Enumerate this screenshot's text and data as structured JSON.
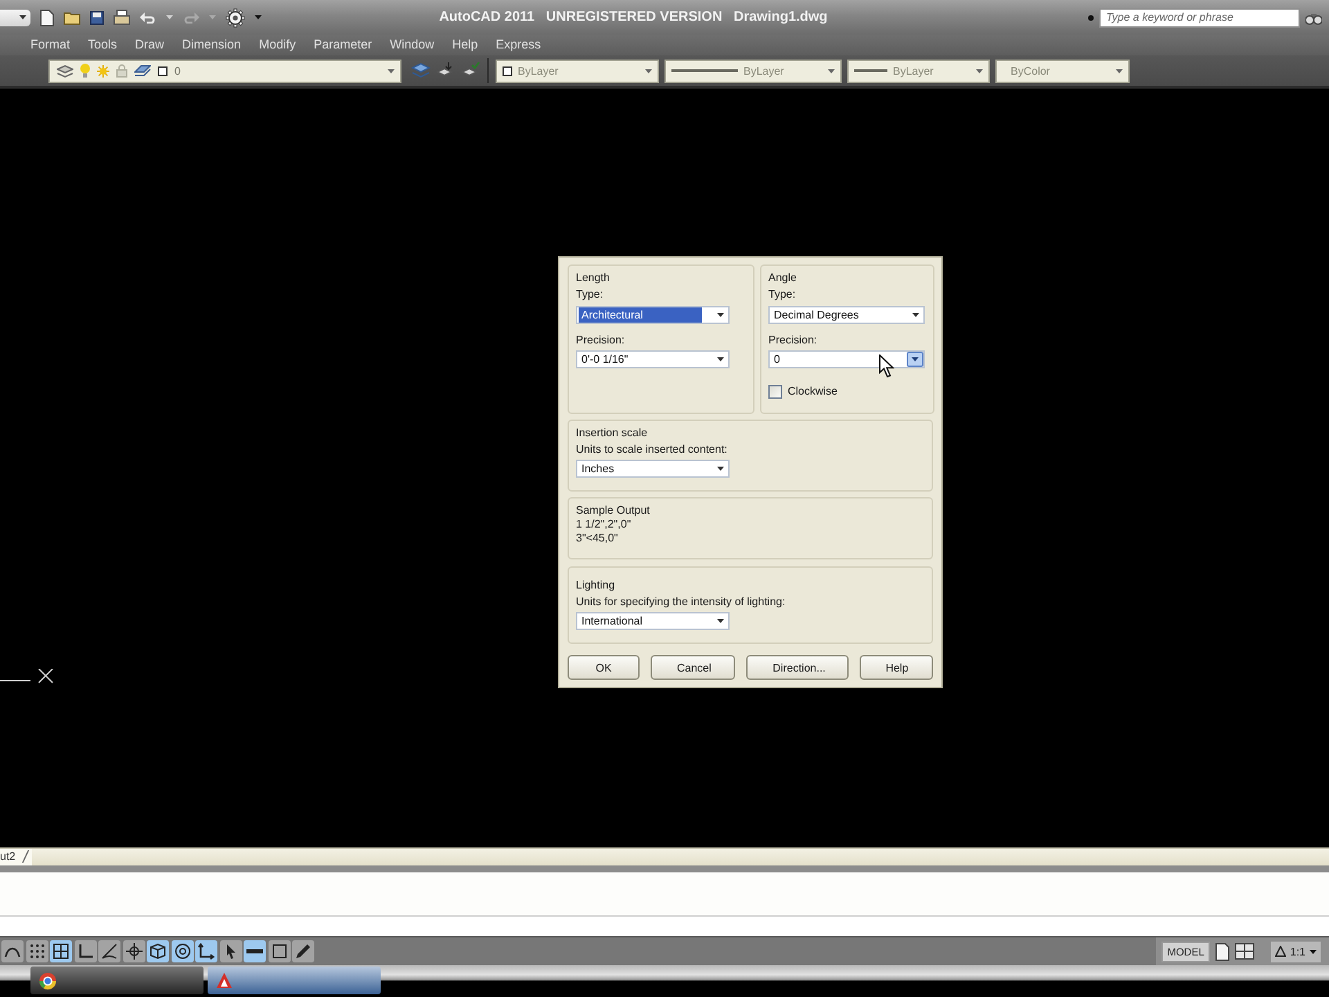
{
  "title_bar": {
    "title": "AutoCAD 2011   UNREGISTERED VERSION   Drawing1.dwg",
    "search": {
      "placeholder": "Type a keyword or phrase"
    }
  },
  "menu_bar": {
    "items": [
      "Format",
      "Tools",
      "Draw",
      "Dimension",
      "Modify",
      "Parameter",
      "Window",
      "Help",
      "Express"
    ]
  },
  "properties_toolbar": {
    "layer": "0",
    "color_setting": "ByLayer",
    "linetype": "ByLayer",
    "lineweight": "ByLayer",
    "plot_style": "ByColor"
  },
  "units_dialog": {
    "length": {
      "title": "Length",
      "type": {
        "label": "Type:",
        "value": "Architectural",
        "highlighted": true
      },
      "precision": {
        "label": "Precision:",
        "value": "0'-0 1/16\"",
        "highlighted": false
      }
    },
    "angle": {
      "title": "Angle",
      "type": {
        "label": "Type:",
        "value": "Decimal Degrees",
        "highlighted": false
      },
      "precision": {
        "label": "Precision:",
        "value": "0",
        "highlighted": false,
        "hovered": true
      },
      "clockwise": {
        "label": "Clockwise",
        "checked": false
      }
    },
    "insertion_scale": {
      "title": "Insertion scale",
      "units": {
        "label": "Units to scale inserted content:",
        "value": "Inches",
        "highlighted": false
      }
    },
    "sample_output": {
      "title": "Sample Output",
      "lines": [
        "1 1/2\",2\",0\"",
        "3\"<45,0\""
      ]
    },
    "lighting": {
      "title": "Lighting",
      "units": {
        "label": "Units for specifying the intensity of lighting:",
        "value": "International",
        "highlighted": false
      }
    },
    "buttons": [
      "OK",
      "Cancel",
      "Direction...",
      "Help"
    ]
  },
  "layout_tab": {
    "label": "ut2"
  },
  "status_bar": {
    "toggles": [
      {
        "on": false
      },
      {
        "on": false
      },
      {
        "on": true
      },
      {
        "on": false
      },
      {
        "on": false
      },
      {
        "on": false
      },
      {
        "on": true
      },
      {
        "on": true
      },
      {
        "on": true
      },
      {
        "on": false
      },
      {
        "on": true
      },
      {
        "on": false
      },
      {
        "on": false
      }
    ],
    "model_button": "MODEL",
    "annotation_scale": "1:1"
  }
}
